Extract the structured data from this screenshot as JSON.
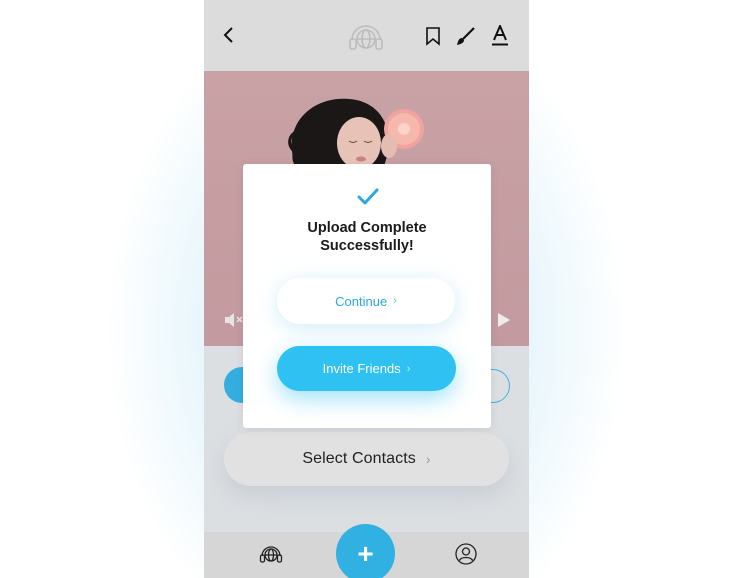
{
  "modal": {
    "title_line1": "Upload Complete",
    "title_line2": "Successfully!",
    "continue_label": "Continue",
    "invite_label": "Invite Friends"
  },
  "main": {
    "select_contacts_label": "Select Contacts"
  },
  "bottom_nav": {
    "fab_label": "+"
  },
  "icons": {
    "back": "back-arrow-icon",
    "logo": "globe-headphones-logo",
    "bookmark": "bookmark-icon",
    "brush": "brush-icon",
    "text": "text-format-icon",
    "mute": "mute-icon",
    "play": "play-icon",
    "check": "check-icon",
    "globe": "globe-headphones-icon",
    "profile": "profile-icon"
  },
  "colors": {
    "accent": "#2ec1f2",
    "accent_text": "#2ba8dc",
    "photo_bg": "#c9a2a5"
  }
}
